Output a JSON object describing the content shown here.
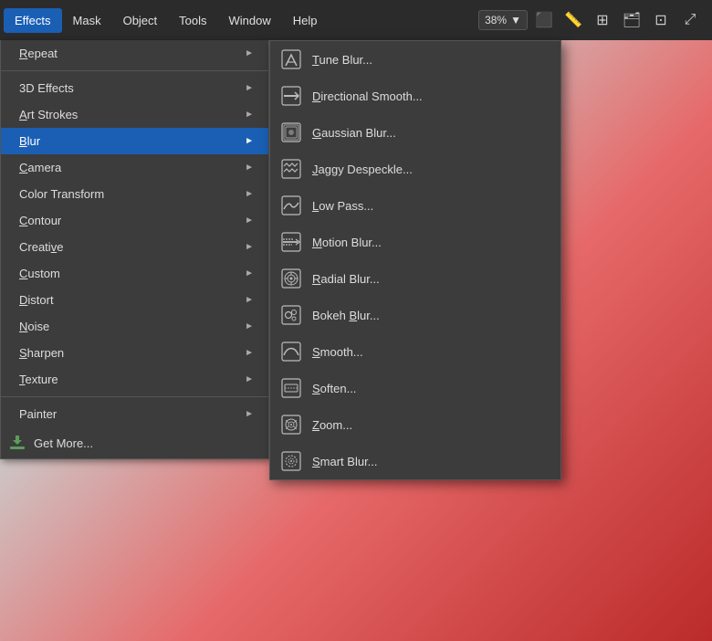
{
  "menubar": {
    "items": [
      {
        "label": "Effects",
        "id": "effects",
        "active": true
      },
      {
        "label": "Mask",
        "id": "mask"
      },
      {
        "label": "Object",
        "id": "object"
      },
      {
        "label": "Tools",
        "id": "tools"
      },
      {
        "label": "Window",
        "id": "window"
      },
      {
        "label": "Help",
        "id": "help"
      }
    ]
  },
  "toolbar": {
    "zoom": "38%",
    "zoom_arrow": "▼",
    "icons": [
      "⬜",
      "⬜",
      "⬜",
      "⬜",
      "⬜"
    ]
  },
  "effects_menu": {
    "items": [
      {
        "id": "repeat",
        "label": "Repeat",
        "has_arrow": true
      },
      {
        "id": "3d-effects",
        "label": "3D Effects",
        "has_arrow": true
      },
      {
        "id": "art-strokes",
        "label": "Art Strokes",
        "has_arrow": true
      },
      {
        "id": "blur",
        "label": "Blur",
        "has_arrow": true,
        "active": true
      },
      {
        "id": "camera",
        "label": "Camera",
        "has_arrow": true
      },
      {
        "id": "color-transform",
        "label": "Color Transform",
        "has_arrow": true
      },
      {
        "id": "contour",
        "label": "Contour",
        "has_arrow": true
      },
      {
        "id": "creative",
        "label": "Creative",
        "has_arrow": true
      },
      {
        "id": "custom",
        "label": "Custom",
        "has_arrow": true
      },
      {
        "id": "distort",
        "label": "Distort",
        "has_arrow": true
      },
      {
        "id": "noise",
        "label": "Noise",
        "has_arrow": true
      },
      {
        "id": "sharpen",
        "label": "Sharpen",
        "has_arrow": true
      },
      {
        "id": "texture",
        "label": "Texture",
        "has_arrow": true
      },
      {
        "id": "painter",
        "label": "Painter",
        "has_arrow": true
      },
      {
        "id": "get-more",
        "label": "Get More...",
        "has_arrow": false
      }
    ]
  },
  "blur_submenu": {
    "items": [
      {
        "id": "tune-blur",
        "label": "Tune Blur...",
        "shortcut_index": 0
      },
      {
        "id": "directional-smooth",
        "label": "Directional Smooth...",
        "shortcut_index": 0
      },
      {
        "id": "gaussian-blur",
        "label": "Gaussian Blur...",
        "shortcut_index": 0
      },
      {
        "id": "jaggy-despeckle",
        "label": "Jaggy Despeckle...",
        "shortcut_index": 0
      },
      {
        "id": "low-pass",
        "label": "Low Pass...",
        "shortcut_index": 0
      },
      {
        "id": "motion-blur",
        "label": "Motion Blur...",
        "shortcut_index": 0
      },
      {
        "id": "radial-blur",
        "label": "Radial Blur...",
        "shortcut_index": 0
      },
      {
        "id": "bokeh-blur",
        "label": "Bokeh Blur...",
        "shortcut_index": 5
      },
      {
        "id": "smooth",
        "label": "Smooth...",
        "shortcut_index": 0
      },
      {
        "id": "soften",
        "label": "Soften...",
        "shortcut_index": 0
      },
      {
        "id": "zoom",
        "label": "Zoom...",
        "shortcut_index": 0
      },
      {
        "id": "smart-blur",
        "label": "Smart Blur...",
        "shortcut_index": 0
      }
    ]
  }
}
